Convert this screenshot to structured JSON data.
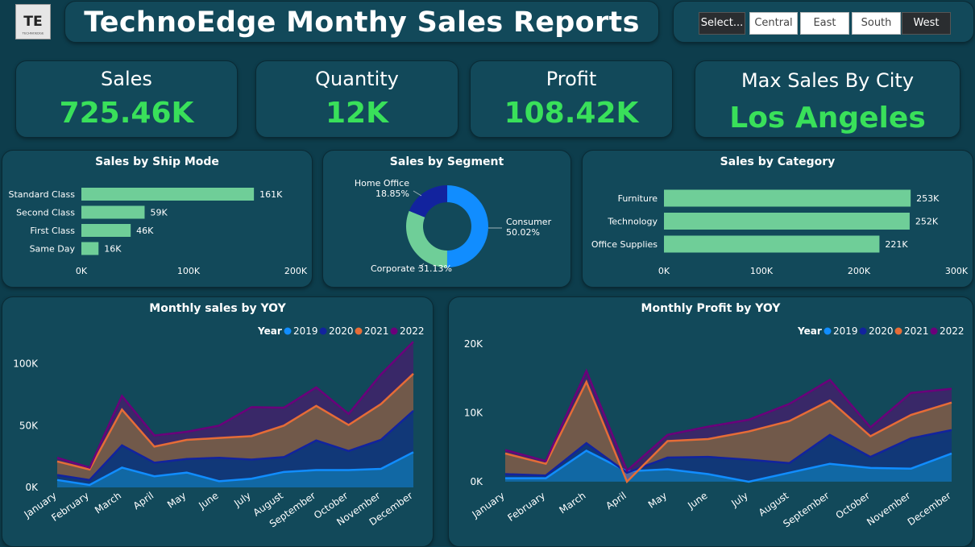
{
  "header": {
    "title": "TechnoEdge Monthy Sales Reports",
    "logo_text": "TE",
    "logo_caption": "TECHNOEDGE"
  },
  "filters": {
    "items": [
      "Select...",
      "Central",
      "East",
      "South",
      "West"
    ]
  },
  "kpis": [
    {
      "label": "Sales",
      "value": "725.46K"
    },
    {
      "label": "Quantity",
      "value": "12K"
    },
    {
      "label": "Profit",
      "value": "108.42K"
    },
    {
      "label": "Max Sales By City",
      "value": "Los Angeles"
    }
  ],
  "colors": {
    "bar": "#6fce98",
    "y2019": "#118dff",
    "y2020": "#12239e",
    "y2021": "#e66c37",
    "y2022": "#6b007b",
    "kpi_value": "#39e05a",
    "background": "#0d3d4c",
    "panel": "#12495a"
  },
  "chart_data": [
    {
      "type": "bar",
      "title": "Sales by Ship Mode",
      "categories": [
        "Standard Class",
        "Second Class",
        "First Class",
        "Same Day"
      ],
      "values": [
        161000,
        59000,
        46000,
        16000
      ],
      "data_labels": [
        "161K",
        "59K",
        "46K",
        "16K"
      ],
      "xlim": [
        0,
        200000
      ],
      "xticks": [
        "0K",
        "100K",
        "200K"
      ],
      "orientation": "horizontal"
    },
    {
      "type": "pie",
      "title": "Sales by Segment",
      "donut": true,
      "slices": [
        {
          "name": "Consumer",
          "value": 50.02,
          "label": "50.02%"
        },
        {
          "name": "Corporate",
          "value": 31.13,
          "label": "31.13%"
        },
        {
          "name": "Home Office",
          "value": 18.85,
          "label": "18.85%"
        }
      ]
    },
    {
      "type": "bar",
      "title": "Sales by Category",
      "categories": [
        "Furniture",
        "Technology",
        "Office Supplies"
      ],
      "values": [
        253000,
        252000,
        221000
      ],
      "data_labels": [
        "253K",
        "252K",
        "221K"
      ],
      "xlim": [
        0,
        300000
      ],
      "xticks": [
        "0K",
        "100K",
        "200K",
        "300K"
      ],
      "orientation": "horizontal"
    },
    {
      "type": "area",
      "title": "Monthly sales by YOY",
      "stacked": true,
      "legend_title": "Year",
      "categories": [
        "January",
        "February",
        "March",
        "April",
        "May",
        "June",
        "July",
        "August",
        "September",
        "October",
        "November",
        "December"
      ],
      "ylim": [
        0,
        120000
      ],
      "yticks": [
        {
          "value": 0,
          "label": "0K"
        },
        {
          "value": 50000,
          "label": "50K"
        },
        {
          "value": 100000,
          "label": "100K"
        }
      ],
      "series": [
        {
          "name": "2019",
          "values": [
            6000,
            2000,
            16000,
            9000,
            12000,
            5000,
            7000,
            12500,
            14000,
            14000,
            15000,
            28500
          ]
        },
        {
          "name": "2020",
          "values": [
            4000,
            4000,
            18000,
            11000,
            11000,
            19000,
            15500,
            12000,
            24000,
            15500,
            23500,
            33500
          ]
        },
        {
          "name": "2021",
          "values": [
            11000,
            8500,
            29000,
            13000,
            15500,
            16000,
            19000,
            25500,
            28000,
            21000,
            29000,
            30000
          ]
        },
        {
          "name": "2022",
          "values": [
            3000,
            1500,
            11000,
            9000,
            6500,
            10000,
            23500,
            14500,
            15000,
            9000,
            24000,
            26000
          ]
        }
      ]
    },
    {
      "type": "area",
      "title": "Monthly Profit by YOY",
      "stacked": true,
      "legend_title": "Year",
      "categories": [
        "January",
        "February",
        "March",
        "April",
        "May",
        "June",
        "July",
        "August",
        "September",
        "October",
        "November",
        "December"
      ],
      "ylim": [
        -2000,
        22000
      ],
      "yticks": [
        {
          "value": 0,
          "label": "0K"
        },
        {
          "value": 10000,
          "label": "10K"
        },
        {
          "value": 20000,
          "label": "20K"
        }
      ],
      "series": [
        {
          "name": "2019",
          "values": [
            500,
            500,
            4500,
            1500,
            1800,
            1100,
            0,
            1300,
            2600,
            2000,
            1900,
            4100
          ]
        },
        {
          "name": "2020",
          "values": [
            600,
            400,
            1100,
            -200,
            1700,
            2500,
            3200,
            1400,
            4200,
            1600,
            4400,
            3400
          ]
        },
        {
          "name": "2021",
          "values": [
            3000,
            1700,
            8900,
            -1300,
            2400,
            2600,
            4100,
            6100,
            5000,
            3000,
            3400,
            4000
          ]
        },
        {
          "name": "2022",
          "values": [
            500,
            400,
            1600,
            1600,
            900,
            1800,
            1700,
            2500,
            3000,
            1300,
            3200,
            2000
          ]
        }
      ]
    }
  ]
}
